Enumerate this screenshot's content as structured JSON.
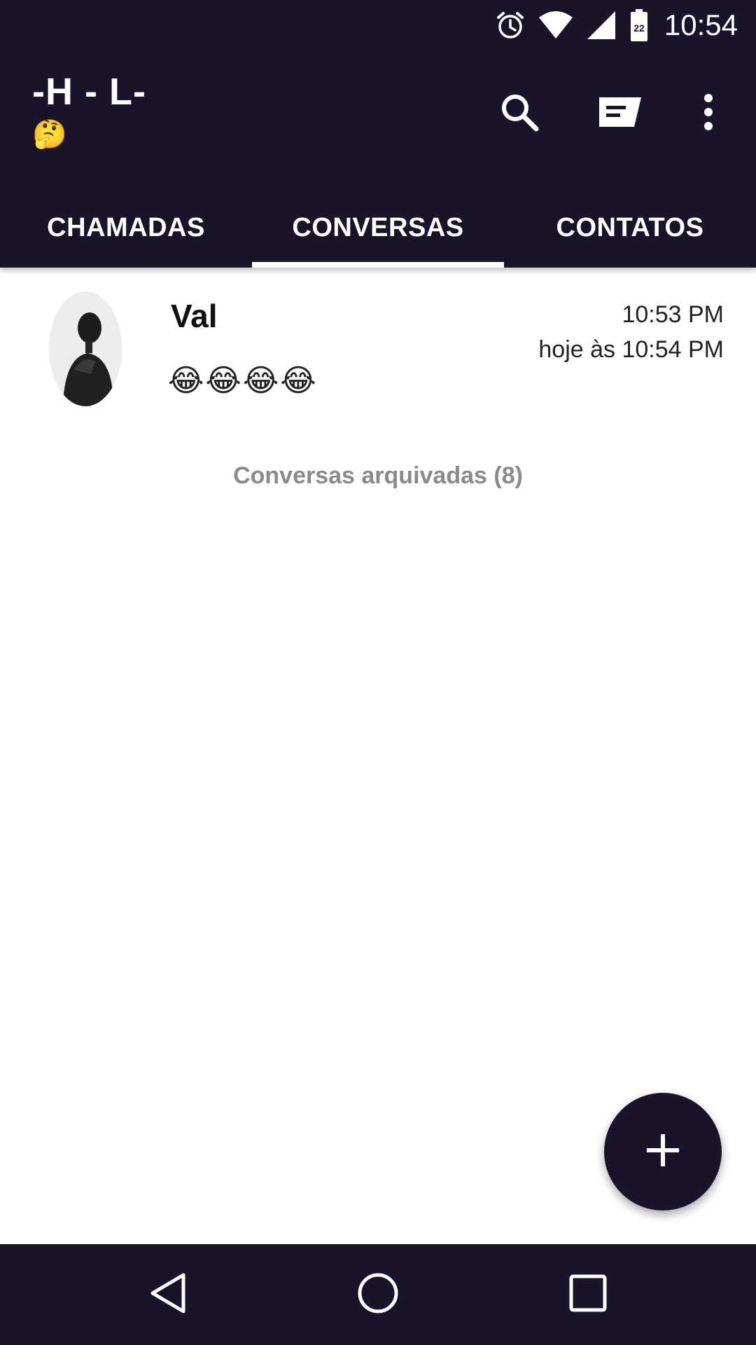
{
  "status_bar": {
    "time": "10:54",
    "battery_level": "22",
    "icons": [
      "alarm-icon",
      "wifi-icon",
      "signal-icon",
      "battery-icon"
    ]
  },
  "app_bar": {
    "title": "-H - L-",
    "subtitle_emoji": "🤔",
    "actions": [
      "search-icon",
      "new-message-icon",
      "more-options-icon"
    ],
    "background_color": "#191429"
  },
  "tabs": [
    {
      "label": "CHAMADAS",
      "active": false
    },
    {
      "label": "CONVERSAS",
      "active": true
    },
    {
      "label": "CONTATOS",
      "active": false
    }
  ],
  "conversations": [
    {
      "name": "Val",
      "time": "10:53 PM",
      "date": "hoje às 10:54 PM",
      "last_message": "😂😂😂😂"
    }
  ],
  "archived_label": "Conversas arquivadas (8)",
  "fab": {
    "icon": "plus-icon"
  },
  "nav_bar": {
    "buttons": [
      "back-icon",
      "home-icon",
      "recents-icon"
    ]
  }
}
